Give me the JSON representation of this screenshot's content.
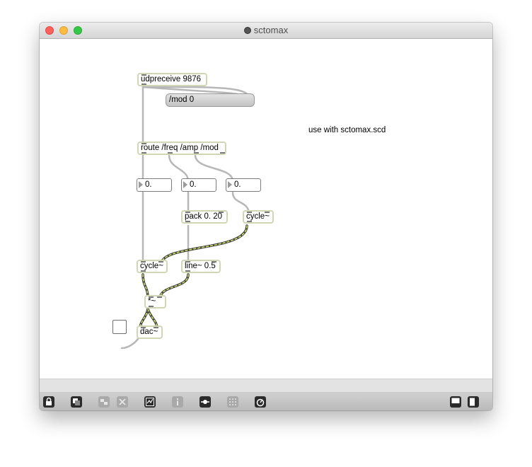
{
  "window": {
    "title": "sctomax"
  },
  "patch": {
    "objects": {
      "udpreceive": "udpreceive 9876",
      "mod_msg": "/mod 0",
      "route": "route /freq /amp /mod",
      "num1": "0.",
      "num2": "0.",
      "num3": "0.",
      "pack": "pack 0. 20",
      "cycle_mod": "cycle~",
      "cycle_main": "cycle~",
      "line": "line~ 0.5",
      "mult": "*~",
      "dac": "dac~"
    },
    "comment": "use with sctomax.scd"
  },
  "toolbar": {
    "left_icons": [
      "lock-icon",
      "presentation-icon",
      "clipping-icon",
      "delete-icon",
      "debug-icon",
      "inspector-icon",
      "connection-icon",
      "grid-icon",
      "audio-icon"
    ],
    "right_icons": [
      "bottom-panel-icon",
      "right-panel-icon"
    ]
  },
  "colors": {
    "object_border": "#cfd7b5",
    "patch_cord": "#b7b7b7",
    "signal_cord_a": "#3c3c3c",
    "signal_cord_b": "#d7e56a",
    "traffic_close": "#fc605c",
    "traffic_min": "#fdbc40",
    "traffic_max": "#34c84a"
  }
}
